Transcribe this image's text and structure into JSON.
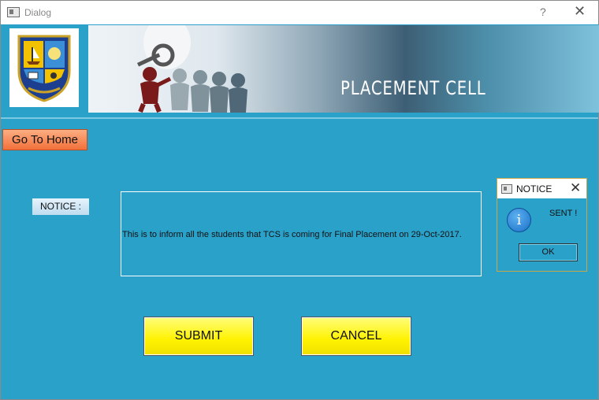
{
  "window": {
    "title": "Dialog",
    "help_glyph": "?",
    "close_glyph": "✕"
  },
  "banner": {
    "title": "PLACEMENT CELL",
    "logo_icon": "college-crest"
  },
  "nav": {
    "home_label": "Go To Home"
  },
  "notice": {
    "label": "NOTICE :",
    "text": "This is to inform all the students that TCS is coming for Final Placement on 29-Oct-2017."
  },
  "actions": {
    "submit_label": "SUBMIT",
    "cancel_label": "CANCEL"
  },
  "message_box": {
    "title": "NOTICE",
    "close_glyph": "✕",
    "icon_glyph": "i",
    "message": "SENT !",
    "ok_label": "OK"
  },
  "colors": {
    "background": "#2aa1c9",
    "home_button": "#f2703b",
    "action_button": "#fff200"
  }
}
